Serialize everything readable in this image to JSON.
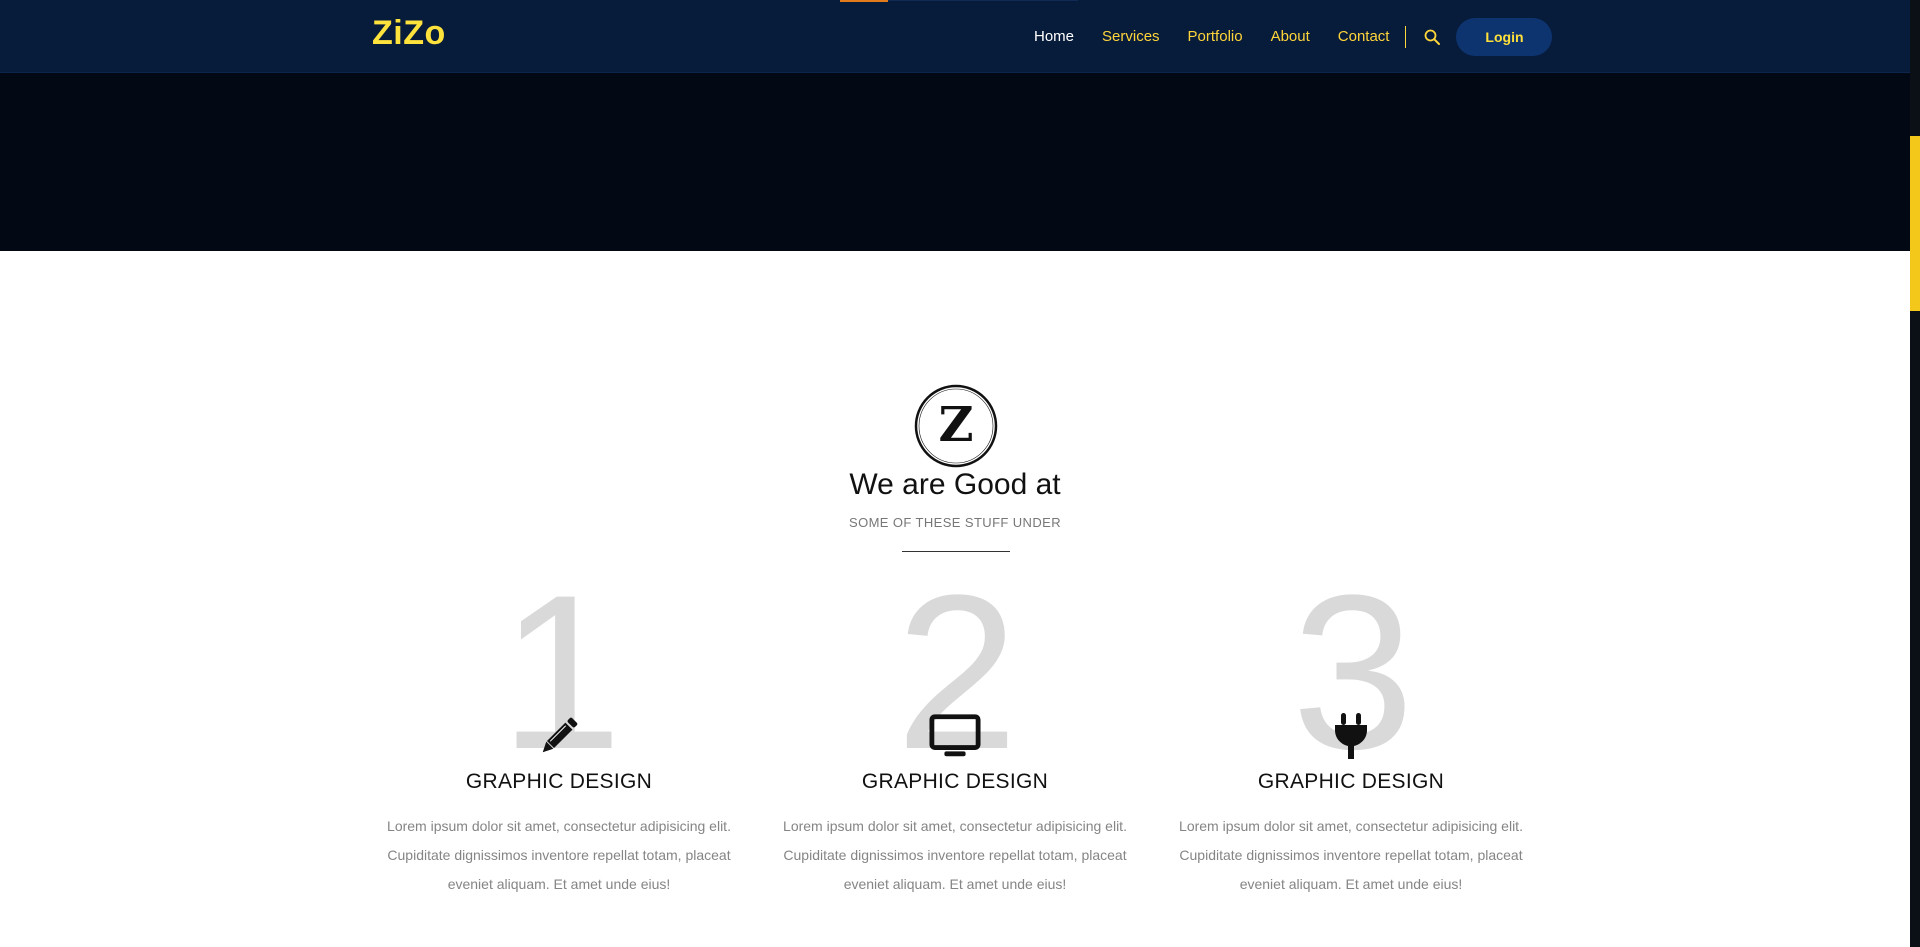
{
  "header": {
    "logo": "ZiZo",
    "nav": [
      {
        "label": "Home",
        "active": true
      },
      {
        "label": "Services",
        "active": false
      },
      {
        "label": "Portfolio",
        "active": false
      },
      {
        "label": "About",
        "active": false
      },
      {
        "label": "Contact",
        "active": false
      }
    ],
    "search_icon": "search-icon",
    "login_label": "Login"
  },
  "section": {
    "logo_letter": "Z",
    "title": "We are Good at",
    "subtitle": "SOME OF THESE STUFF UNDER"
  },
  "services": [
    {
      "number": "1",
      "icon": "pencil-icon",
      "title": "GRAPHIC DESIGN",
      "text": "Lorem ipsum dolor sit amet, consectetur adipisicing elit. Cupiditate dignissimos inventore repellat totam, placeat eveniet aliquam. Et amet unde eius!"
    },
    {
      "number": "2",
      "icon": "monitor-icon",
      "title": "GRAPHIC DESIGN",
      "text": "Lorem ipsum dolor sit amet, consectetur adipisicing elit. Cupiditate dignissimos inventore repellat totam, placeat eveniet aliquam. Et amet unde eius!"
    },
    {
      "number": "3",
      "icon": "plug-icon",
      "title": "GRAPHIC DESIGN",
      "text": "Lorem ipsum dolor sit amet, consectetur adipisicing elit. Cupiditate dignissimos inventore repellat totam, placeat eveniet aliquam. Et amet unde eius!"
    }
  ],
  "colors": {
    "header_bg": "#071b3a",
    "accent_yellow": "#ffe23c",
    "hero_bg": "#020915",
    "scroll_thumb": "#f4c81a"
  }
}
